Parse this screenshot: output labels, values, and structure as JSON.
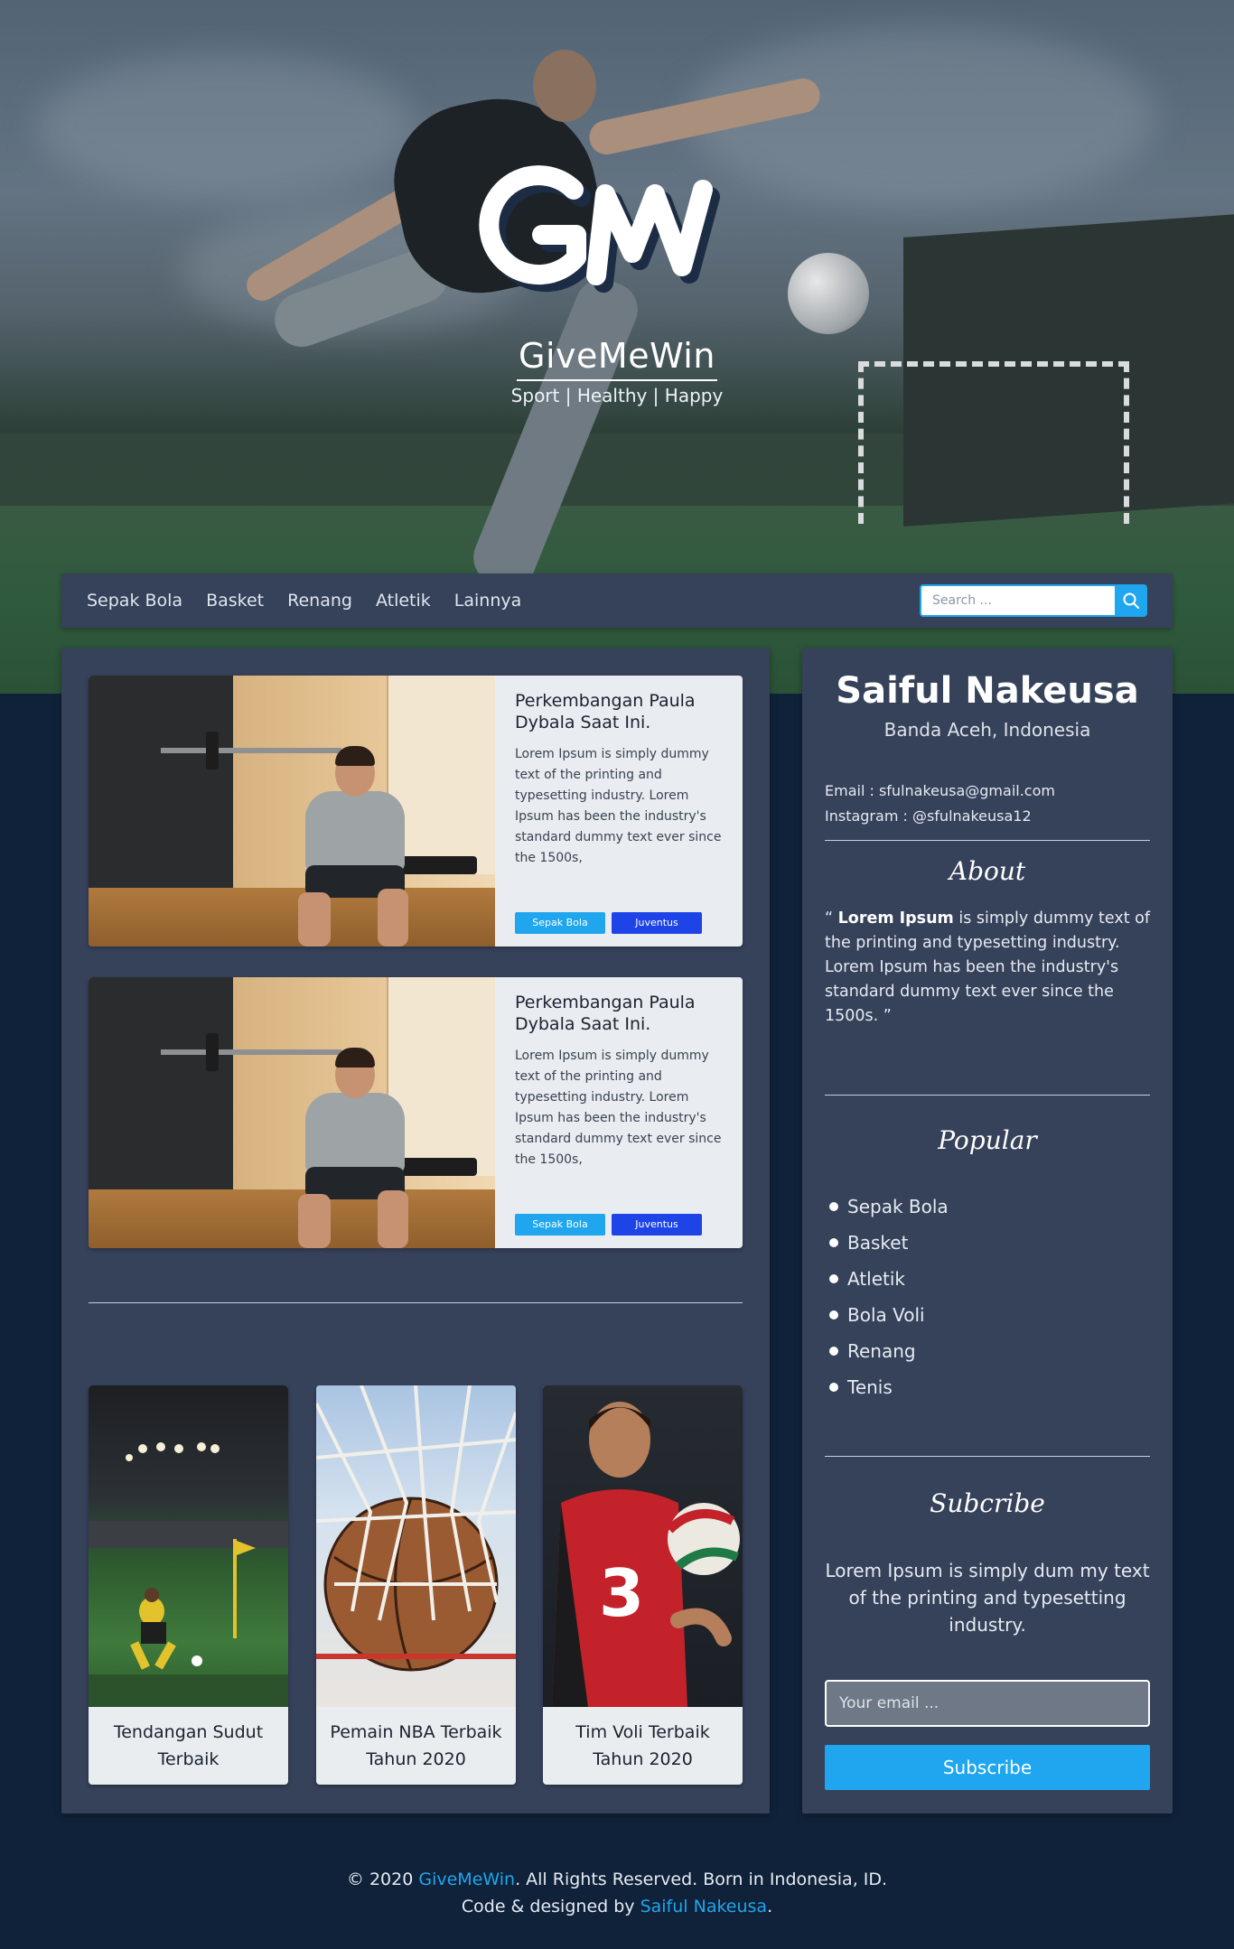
{
  "brand": {
    "logo_text": "GMW",
    "name": "GiveMeWin",
    "tagline": "Sport | Healthy | Happy"
  },
  "nav": {
    "items": [
      "Sepak Bola",
      "Basket",
      "Renang",
      "Atletik",
      "Lainnya"
    ],
    "search_placeholder": "Search ..."
  },
  "posts": [
    {
      "title": "Perkembangan Paula Dybala Saat Ini.",
      "excerpt": "Lorem Ipsum is simply dummy text of the printing and typesetting industry. Lorem Ipsum has been the industry's standard dummy text ever since the 1500s,",
      "tags": [
        "Sepak Bola",
        "Juventus"
      ]
    },
    {
      "title": "Perkembangan Paula Dybala Saat Ini.",
      "excerpt": "Lorem Ipsum is simply dummy text of the printing and typesetting industry. Lorem Ipsum has been the industry's standard dummy text ever since the 1500s,",
      "tags": [
        "Sepak Bola",
        "Juventus"
      ]
    }
  ],
  "cards": [
    {
      "caption": "Tendangan Sudut Terbaik"
    },
    {
      "caption": "Pemain NBA Terbaik Tahun 2020"
    },
    {
      "caption": "Tim Voli Terbaik Tahun 2020"
    }
  ],
  "sidebar": {
    "name": "Saiful Nakeusa",
    "location": "Banda Aceh, Indonesia",
    "email": "Email : sfulnakeusa@gmail.com",
    "instagram": "Instagram : @sfulnakeusa12",
    "about_heading": "About",
    "about_bold": "Lorem Ipsum",
    "about_text": " is simply dummy text of the printing and typesetting industry. Lorem Ipsum has been the industry's standard dummy text ever since the 1500s.",
    "popular_heading": "Popular",
    "popular_items": [
      "Sepak Bola",
      "Basket",
      "Atletik",
      "Bola Voli",
      "Renang",
      "Tenis"
    ],
    "subscribe_heading": "Subcribe",
    "subscribe_text": "Lorem Ipsum is simply dum  my text of the printing and typesetting industry.",
    "email_placeholder": "Your email ...",
    "subscribe_button": "Subscribe"
  },
  "footer": {
    "copyright_prefix": "© 2020 ",
    "brand": "GiveMeWin",
    "copyright_suffix": ". All Rights Reserved. Born in Indonesia, ID.",
    "credit_prefix": "Code & designed by ",
    "author": "Saiful Nakeusa",
    "credit_suffix": "."
  },
  "colors": {
    "accent": "#1fa6ee",
    "tag_dark": "#1e44e8",
    "panel": "#36415a",
    "background": "#10223a"
  }
}
